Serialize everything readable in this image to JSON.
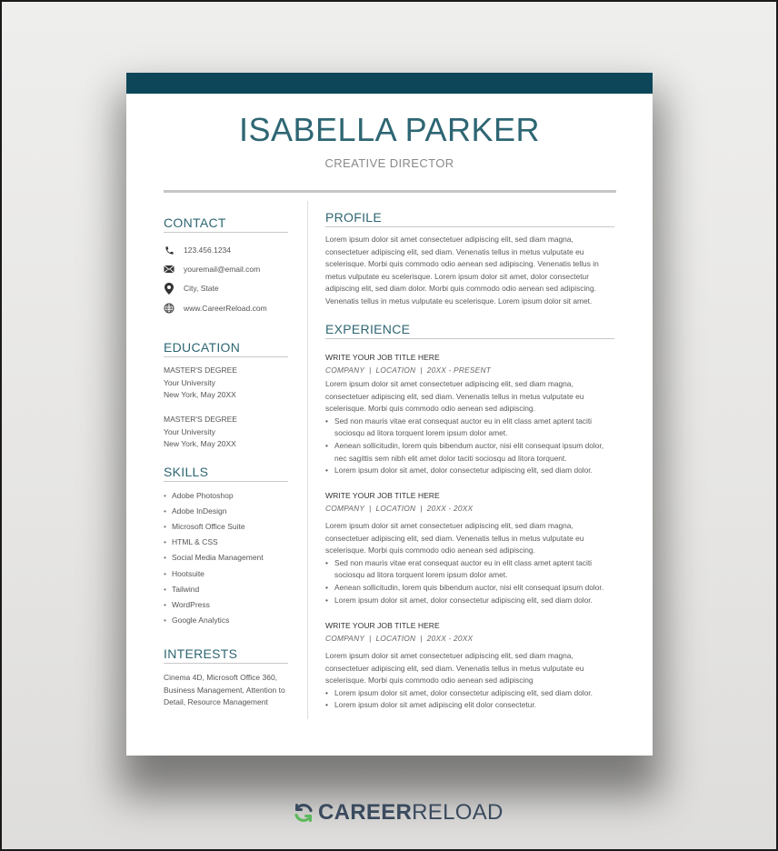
{
  "resume": {
    "name": "ISABELLA PARKER",
    "role": "CREATIVE DIRECTOR",
    "accent_color": "#0d4658",
    "heading_color": "#2e6673",
    "contact": {
      "title": "CONTACT",
      "items": [
        {
          "icon": "phone-icon",
          "text": "123.456.1234"
        },
        {
          "icon": "envelope-icon",
          "text": "youremail@email.com"
        },
        {
          "icon": "location-pin-icon",
          "text": "City, State"
        },
        {
          "icon": "globe-icon",
          "text": "www.CareerReload.com"
        }
      ]
    },
    "education": {
      "title": "EDUCATION",
      "items": [
        {
          "degree": "MASTER'S DEGREE",
          "school": "Your University",
          "place_date": "New York, May 20XX"
        },
        {
          "degree": "MASTER'S DEGREE",
          "school": "Your University",
          "place_date": "New York, May 20XX"
        }
      ]
    },
    "skills": {
      "title": "SKILLS",
      "items": [
        "Adobe Photoshop",
        "Adobe InDesign",
        "Microsoft Office Suite",
        "HTML & CSS",
        "Social Media Management",
        "Hootsuite",
        "Tailwind",
        "WordPress",
        "Google Analytics"
      ]
    },
    "interests": {
      "title": "INTERESTS",
      "text": "Cinema 4D, Microsoft Office 360, Business Management, Attention to Detail, Resource Management"
    },
    "profile": {
      "title": "PROFILE",
      "text": "Lorem ipsum dolor sit amet consectetuer adipiscing elit, sed diam magna, consectetuer adipiscing elit, sed diam. Venenatis tellus in metus vulputate eu scelerisque. Morbi quis commodo odio aenean sed adipiscing. Venenatis tellus in metus vulputate eu scelerisque. Lorem ipsum dolor sit amet, dolor consectetur adipiscing elit, sed diam dolor. Morbi quis commodo odio aenean sed adipiscing. Venenatis tellus in metus vulputate eu scelerisque. Lorem ipsum dolor sit amet."
    },
    "experience": {
      "title": "EXPERIENCE",
      "jobs": [
        {
          "title": "WRITE YOUR JOB TITLE HERE",
          "meta": "COMPANY  |  LOCATION  |  20XX - PRESENT",
          "summary": "Lorem ipsum dolor sit amet consectetuer adipiscing elit, sed diam magna, consectetuer adipiscing elit, sed diam. Venenatis tellus in metus vulputate eu scelerisque. Morbi quis commodo odio aenean sed adipiscing.",
          "bullets": [
            "Sed non  mauris vitae erat consequat auctor eu in elit class  amet aptent taciti sociosqu ad litora torquent lorem ipsum dolor amet.",
            "Aenean sollicitudin, lorem quis bibendum auctor, nisi elit consequat ipsum dolor, nec sagittis sem nibh elit amet dolor taciti sociosqu ad litora torquent.",
            "Lorem ipsum dolor sit amet, dolor consectetur adipiscing elit, sed diam dolor."
          ]
        },
        {
          "title": "WRITE YOUR JOB TITLE HERE",
          "meta": "COMPANY  |  LOCATION  |  20XX - 20XX",
          "summary": "Lorem ipsum dolor sit amet consectetuer adipiscing elit, sed diam magna, consectetuer adipiscing elit, sed diam. Venenatis tellus in metus vulputate eu scelerisque. Morbi quis commodo odio aenean sed adipiscing.",
          "bullets": [
            "Sed non  mauris vitae erat consequat auctor eu in elit class  amet aptent taciti sociosqu ad litora torquent lorem ipsum dolor amet.",
            "Aenean sollicitudin, lorem quis bibendum auctor, nisi elit consequat ipsum dolor.",
            "Lorem ipsum dolor sit amet, dolor consectetur adipiscing elit, sed diam dolor."
          ]
        },
        {
          "title": "WRITE YOUR JOB TITLE HERE",
          "meta": "COMPANY  |  LOCATION  |  20XX - 20XX",
          "summary": "Lorem ipsum dolor sit amet consectetuer adipiscing elit, sed diam magna, consectetuer adipiscing elit, sed diam. Venenatis tellus in metus vulputate eu scelerisque. Morbi quis commodo odio aenean sed adipiscing",
          "bullets": [
            "Lorem ipsum dolor sit amet, dolor consectetur adipiscing elit, sed diam dolor.",
            "Lorem ipsum dolor sit amet adipiscing elit dolor consectetur."
          ]
        }
      ]
    }
  },
  "branding": {
    "logo_icon": "reload-arrows-icon",
    "logo_bold": "CAREER",
    "logo_light": "RELOAD",
    "logo_arrow_colors": [
      "#3a4a5e",
      "#5cb85c"
    ]
  }
}
